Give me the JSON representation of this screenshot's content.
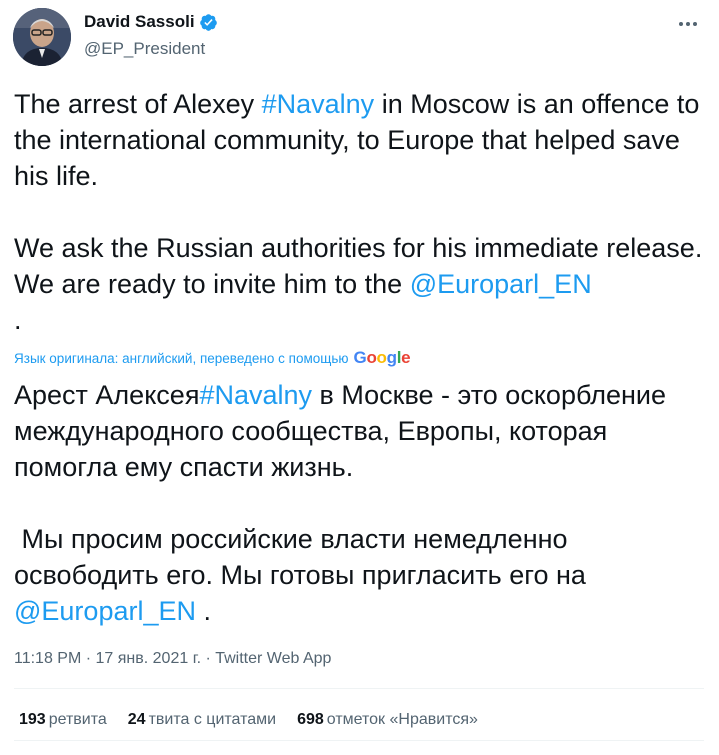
{
  "author": {
    "name": "David Sassoli",
    "handle": "@EP_President"
  },
  "tweet": {
    "p1": [
      {
        "t": "The arrest of Alexey ",
        "k": "text"
      },
      {
        "t": "#Navalny",
        "k": "tag"
      },
      {
        "t": " in Moscow is an offence to the international community, to Europe that helped save his life.",
        "k": "text"
      }
    ],
    "p2": [
      {
        "t": "We ask the Russian authorities for his immediate release. We are ready to invite him to the ",
        "k": "text"
      },
      {
        "t": "@Europarl_EN",
        "k": "mention"
      },
      {
        "t": "\n.",
        "k": "text"
      }
    ]
  },
  "translation": {
    "notice": "Язык оригинала: английский, переведено с помощью",
    "provider": "Google",
    "p1": [
      {
        "t": "Арест Алексея",
        "k": "text"
      },
      {
        "t": "#Navalny",
        "k": "tag"
      },
      {
        "t": " в Москве - это оскорбление международного сообщества, Европы, которая помогла ему спасти жизнь.",
        "k": "text"
      }
    ],
    "p2": [
      {
        "t": " Мы просим российские власти немедленно освободить его. Мы готовы пригласить его на ",
        "k": "text"
      },
      {
        "t": "@Europarl_EN",
        "k": "mention"
      },
      {
        "t": " .",
        "k": "text"
      }
    ]
  },
  "meta": {
    "time": "11:18 PM",
    "date": "17 янв. 2021 г.",
    "source": "Twitter Web App",
    "sep": " · "
  },
  "stats": {
    "retweets": {
      "count": "193",
      "label": "ретвита"
    },
    "quotes": {
      "count": "24",
      "label": "твита с цитатами"
    },
    "likes": {
      "count": "698",
      "label": "отметок «Нравится»"
    }
  },
  "colors": {
    "link": "#1d9bf0",
    "text": "#0f1419",
    "muted": "#536471"
  },
  "icons": [
    "verified-badge-icon",
    "more-options-icon",
    "google-logo"
  ]
}
